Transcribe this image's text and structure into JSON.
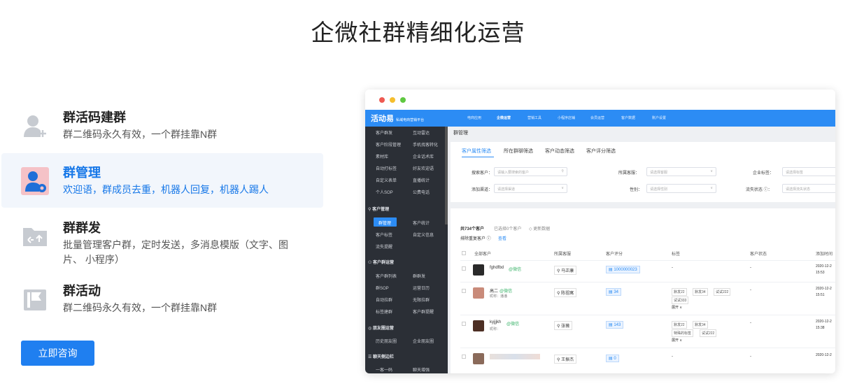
{
  "title": "企微社群精细化运营",
  "features": [
    {
      "title": "群活码建群",
      "desc": "群二维码永久有效，一个群挂靠N群",
      "icon": "user-add-icon"
    },
    {
      "title": "群管理",
      "desc": "欢迎语，群成员去重，机器人回复，机器人踢人",
      "icon": "user-gear-icon"
    },
    {
      "title": "群群发",
      "desc": "批量管理客户群，定时发送，多消息模版（文字、图片、 小程序）",
      "icon": "folder-share-icon"
    },
    {
      "title": "群活动",
      "desc": "群二维码永久有效，一个群挂靠N群",
      "icon": "flag-icon"
    }
  ],
  "cta": "立即咨询",
  "app": {
    "logo": "活动易",
    "logo_sub": "私域电商营销平台",
    "topnav": [
      "电商应用",
      "企微运营",
      "营销工具",
      "小程序店铺",
      "会员运营",
      "客户数据",
      "账户设置"
    ],
    "sidebar_top": [
      [
        "客户群发",
        "互动雷达"
      ],
      [
        "客户阶段管理",
        "手机找客转化"
      ],
      [
        "素材库",
        "企业话术库"
      ],
      [
        "自动打标签",
        "好友欢迎语"
      ],
      [
        "自定义表单",
        "直播统计"
      ],
      [
        "个人SOP",
        "公费电话"
      ]
    ],
    "sidebar_sections": [
      {
        "head": "客户管理",
        "rows": [
          [
            "群管理",
            "客户统计"
          ],
          [
            "客户标签",
            "自定义信息"
          ],
          [
            "流失提醒",
            ""
          ]
        ]
      },
      {
        "head": "客户群运营",
        "rows": [
          [
            "客户群列表",
            "群群发"
          ],
          [
            "群SOP",
            "运营日历"
          ],
          [
            "自动拉群",
            "无限拉群"
          ],
          [
            "标签建群",
            "客户群提醒"
          ]
        ]
      },
      {
        "head": "朋友圈运营",
        "rows": [
          [
            "历史朋友圈",
            "企业朋友圈"
          ]
        ]
      },
      {
        "head": "聊天侧边栏",
        "rows": [
          [
            "一客一码",
            "聊天增强"
          ]
        ]
      }
    ],
    "breadcrumb": "群管理",
    "filter_tabs": [
      "客户属性筛选",
      "所在群聊筛选",
      "客户动态筛选",
      "客户评分筛选"
    ],
    "filters": {
      "search_label": "搜索客户：",
      "search_ph": "请输入要搜索的客户",
      "group_label": "所属客服：",
      "group_ph": "请选择客服",
      "corp_label": "企业标签：",
      "corp_ph": "请选择标签",
      "channel_label": "添加渠道：",
      "channel_ph": "请选择渠道",
      "gender_label": "性别：",
      "gender_ph": "请选择性别",
      "loss_label": "流失状态 ⓘ：",
      "loss_ph": "请选择流失状态"
    },
    "summary": {
      "total": "共734个客户",
      "selected": "已选择0个客户",
      "update": "◇ 更新数据",
      "dedupe": "排除重复客户 ⓘ",
      "view": "查看"
    },
    "columns": [
      "全部客户",
      "所属客服",
      "客户评分",
      "标签",
      "客户状态",
      "添加时间"
    ],
    "rows": [
      {
        "name": "fghdfbd",
        "source": "@微信",
        "remark": "",
        "owner": "马正康",
        "score": "1000000023",
        "tags": [
          "-"
        ],
        "status": "-",
        "date": "2020-12-2",
        "time": "15:53"
      },
      {
        "name": "高二",
        "source": "@微信",
        "remark": "昵称：潘潘",
        "owner": "陈祖寓",
        "score": "34",
        "tags": [
          "默发22",
          "默发34",
          "试试222",
          "试试333"
        ],
        "more": "展开 ∨",
        "status": "-",
        "date": "2020-12-2",
        "time": "15:51"
      },
      {
        "name": "kyjjjkh",
        "source": "@微信",
        "remark": "昵称：",
        "owner": "张薇",
        "score": "143",
        "tags": [
          "默发22",
          "默发34",
          "特殊的标签",
          "试试222"
        ],
        "more": "展开 ∨",
        "status": "-",
        "date": "2020-12-2",
        "time": "15:38"
      },
      {
        "name": "",
        "source": "",
        "remark": "",
        "owner": "王振杰",
        "score": "0",
        "tags": [
          "-"
        ],
        "status": "-",
        "date": "2020-12-2",
        "time": ""
      }
    ]
  },
  "colors": {
    "accent": "#1f7ff0",
    "app_blue": "#2c8cf4",
    "sidebar": "#2b2f36",
    "mac_red": "#ee5a52",
    "mac_yellow": "#f5be2e",
    "mac_green": "#5fc840"
  }
}
